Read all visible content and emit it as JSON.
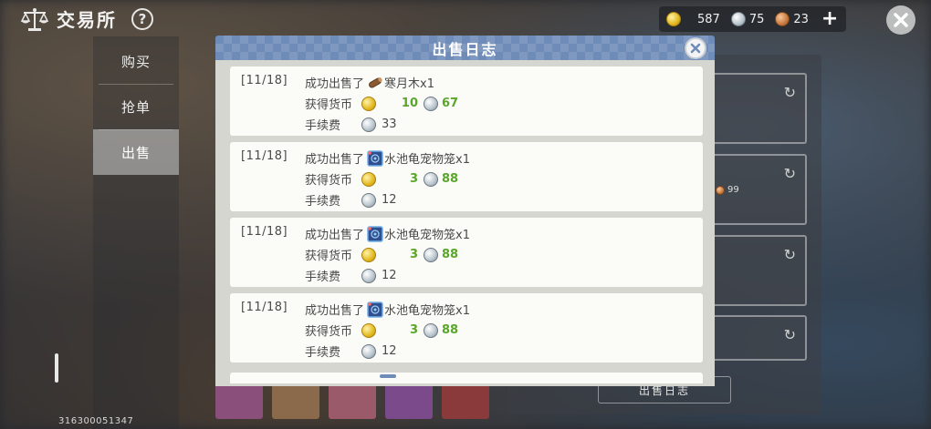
{
  "header": {
    "title": "交易所",
    "help_label": "?"
  },
  "currency": {
    "gold": "587",
    "silver": "75",
    "bronze": "23",
    "add_label": "+"
  },
  "sidebar": {
    "items": [
      {
        "label": "购买"
      },
      {
        "label": "抢单"
      },
      {
        "label": "出售"
      }
    ],
    "active_index": 2
  },
  "user_id": "316300051347",
  "background_panel": {
    "slot2_amount": "99",
    "log_button_label": "出售日志"
  },
  "modal": {
    "title": "出售日志",
    "entries": [
      {
        "date": "[11/18]",
        "action": "成功出售了",
        "item_icon": "wood-log-icon",
        "item": "寒月木x1",
        "earned_label": "获得货币",
        "gold": "10",
        "silver": "67",
        "fee_label": "手续费",
        "fee": "33"
      },
      {
        "date": "[11/18]",
        "action": "成功出售了",
        "item_icon": "pet-cage-icon",
        "item": "水池龟宠物笼x1",
        "earned_label": "获得货币",
        "gold": "3",
        "silver": "88",
        "fee_label": "手续费",
        "fee": "12"
      },
      {
        "date": "[11/18]",
        "action": "成功出售了",
        "item_icon": "pet-cage-icon",
        "item": "水池龟宠物笼x1",
        "earned_label": "获得货币",
        "gold": "3",
        "silver": "88",
        "fee_label": "手续费",
        "fee": "12"
      },
      {
        "date": "[11/18]",
        "action": "成功出售了",
        "item_icon": "pet-cage-icon",
        "item": "水池龟宠物笼x1",
        "earned_label": "获得货币",
        "gold": "3",
        "silver": "88",
        "fee_label": "手续费",
        "fee": "12"
      }
    ]
  },
  "colors": {
    "header_blue": "#6f8cb8",
    "earned_green": "#59a62a",
    "entry_bg": "#fbfbf8",
    "modal_frame": "#d6d6d0"
  }
}
